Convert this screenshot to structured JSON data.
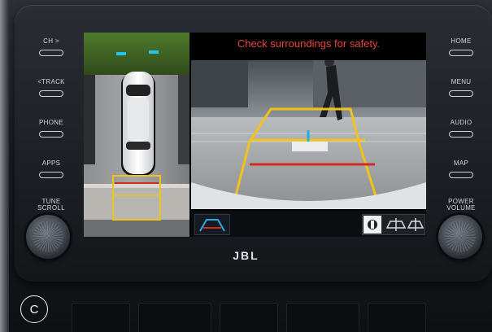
{
  "left_buttons": [
    {
      "label": "CH >"
    },
    {
      "label": "<TRACK"
    },
    {
      "label": "PHONE"
    },
    {
      "label": "APPS"
    }
  ],
  "right_buttons": [
    {
      "label": "HOME"
    },
    {
      "label": "MENU"
    },
    {
      "label": "AUDIO"
    },
    {
      "label": "MAP"
    }
  ],
  "left_knob": {
    "line1": "TUNE",
    "line2": "SCROLL"
  },
  "right_knob": {
    "line1": "POWER",
    "line2": "VOLUME"
  },
  "screen": {
    "warning": "Check surroundings for safety.",
    "icons": [
      "guide-lines-icon",
      "camera-view-1-icon",
      "camera-view-2-icon",
      "camera-view-3-icon"
    ],
    "colors": {
      "warning": "#e8453c",
      "guide_yellow": "#f1c21b",
      "guide_red": "#d62a1f",
      "guide_blue": "#2aa9e0"
    }
  },
  "brand": "JBL",
  "badge": "C"
}
